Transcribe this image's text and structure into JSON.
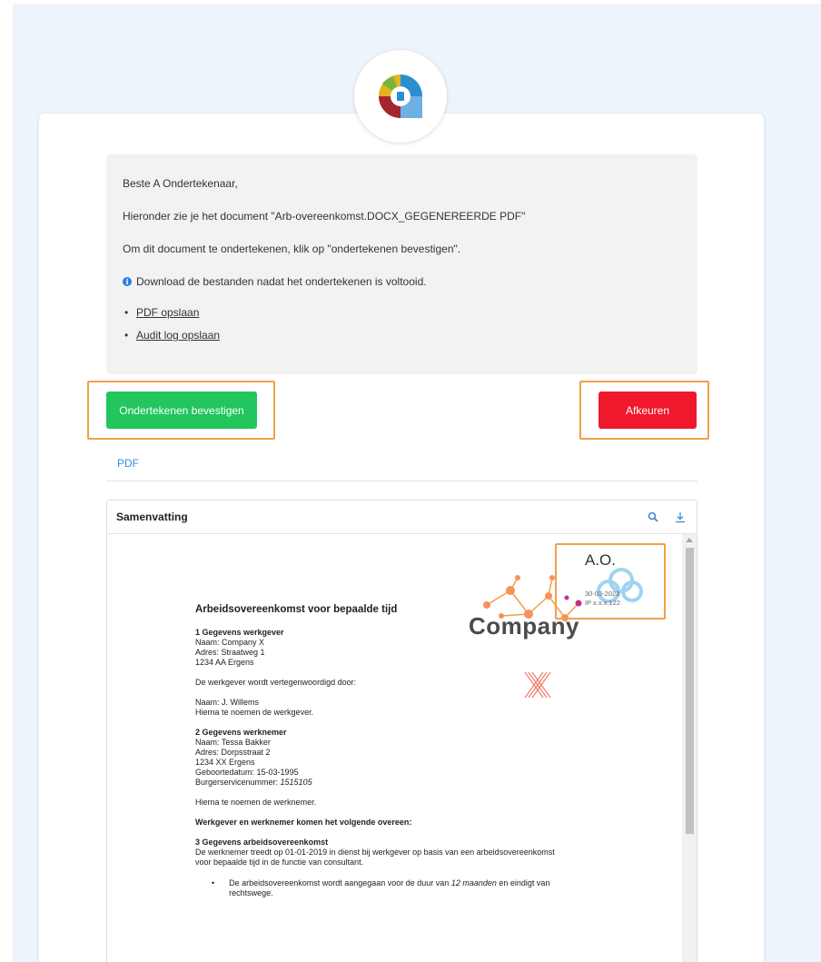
{
  "message": {
    "greeting": "Beste A Ondertekenaar,",
    "intro": "Hieronder zie je het document \"Arb-overeenkomst.DOCX_GEGENEREERDE PDF\"",
    "instruction": "Om dit document te ondertekenen, klik op \"ondertekenen bevestigen\".",
    "info": "Download de bestanden nadat het ondertekenen is voltooid.",
    "links": [
      "PDF opslaan",
      "Audit log opslaan"
    ]
  },
  "actions": {
    "sign_label": "Ondertekenen bevestigen",
    "reject_label": "Afkeuren"
  },
  "tabs": {
    "pdf": "PDF"
  },
  "viewer": {
    "title": "Samenvatting",
    "icons": [
      "search-icon",
      "download-icon"
    ]
  },
  "signature": {
    "initials": "A.O.",
    "date": "30-03-2023",
    "ip": "IP x.x.x.122"
  },
  "company": {
    "word": "Company",
    "letter": "X"
  },
  "document": {
    "title": "Arbeidsovereenkomst voor bepaalde tijd",
    "s1_heading": "1 Gegevens werkgever",
    "s1_name": "Naam: Company X",
    "s1_address": "Adres: Straatweg 1",
    "s1_city": "1234 AA Ergens",
    "represented": "De werkgever wordt vertegenwoordigd door:",
    "rep_name": "Naam: J. Willems",
    "rep_note": "Hierna te noemen de werkgever.",
    "s2_heading": "2 Gegevens werknemer",
    "s2_name": "Naam: Tessa Bakker",
    "s2_address": "Adres: Dorpsstraat 2",
    "s2_city": "1234 XX Ergens",
    "s2_birth": "Geboortedatum: 15-03-1995",
    "s2_bsn_label": "Burgerservicenummer: ",
    "s2_bsn": "1515105",
    "s2_note": "Hierna te noemen de werknemer.",
    "agree": "Werkgever en werknemer komen het volgende overeen:",
    "s3_heading": "3 Gegevens arbeidsovereenkomst",
    "s3_line1": "De werknemer treedt op 01-01-2019 in dienst bij werkgever op basis van een arbeidsovereenkomst",
    "s3_line2": "voor bepaalde tijd in de functie van consultant.",
    "bullet_pre": "De arbeidsovereenkomst wordt aangegaan voor de duur van ",
    "bullet_em": "12 maanden",
    "bullet_post": " en eindigt van",
    "bullet_line2": "rechtswege."
  }
}
